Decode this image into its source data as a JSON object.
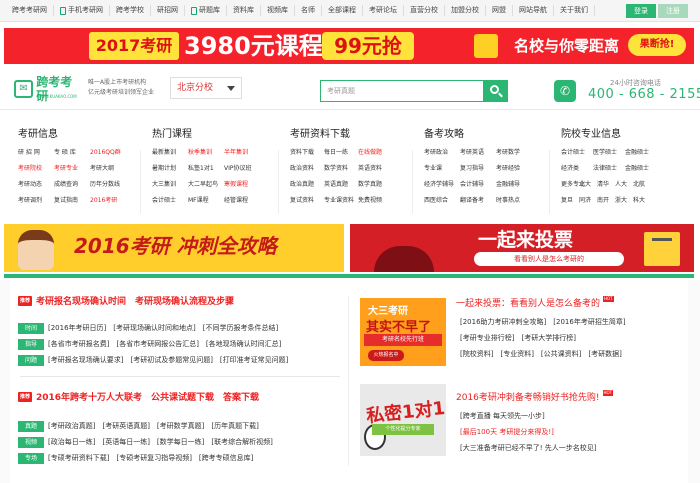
{
  "topbar": {
    "items": [
      "跨考考研网",
      "手机考研网",
      "跨考学校",
      "研招网",
      "研题库",
      "资料库",
      "视频库",
      "名师",
      "全部课程",
      "考研论坛",
      "直营分校",
      "加盟分校",
      "网盟",
      "网站导航",
      "关于我们"
    ],
    "login": "登录",
    "register": "注册",
    "colors": {
      "login": "#2bb673",
      "register": "#a9d9bd"
    }
  },
  "banner": {
    "year": "2017考研",
    "price": "3980元课程",
    "deal": "99元抢",
    "slogan": "名校与你零距离",
    "cta": "果断抢!"
  },
  "header": {
    "logo_name": "跨考考研",
    "logo_sub": "WWW.KUAKAO.COM",
    "slogan1": "唯一A股上市考研机构",
    "slogan2": "亿元级考研培训领军企业",
    "city": "北京分校",
    "search_placeholder": "考研真题",
    "tel_label": "24小时咨询电话",
    "tel": "400 - 668 - 2155"
  },
  "cols": [
    {
      "title": "考研信息",
      "rows": [
        [
          "研 招 网",
          "专 硕 库",
          "2016QQ群"
        ],
        [
          "考研院校",
          "考研专业",
          "考研大纲"
        ],
        [
          "考研动态",
          "成绩查询",
          "历年分数线"
        ],
        [
          "考研调剂",
          "复试指南",
          "2016考研"
        ]
      ],
      "red": [
        [
          0,
          2
        ],
        [
          1,
          0
        ],
        [
          1,
          1
        ],
        [
          3,
          2
        ]
      ]
    },
    {
      "title": "热门课程",
      "rows": [
        [
          "最新集训",
          "秋季集训",
          "半年集训"
        ],
        [
          "暑期计划",
          "私塾1对1",
          "VIP协议班"
        ],
        [
          "大三集训",
          "大二早起鸟",
          "寒假课程"
        ],
        [
          "会计硕士",
          "MF课程",
          "经管课程"
        ]
      ],
      "red": [
        [
          0,
          1
        ],
        [
          0,
          2
        ],
        [
          2,
          2
        ]
      ]
    },
    {
      "title": "考研资料下载",
      "rows": [
        [
          "资料下载",
          "每日一练",
          "在线做题"
        ],
        [
          "政治资料",
          "数学资料",
          "英语资料"
        ],
        [
          "政治真题",
          "英语真题",
          "数学真题"
        ],
        [
          "复试资料",
          "专业课资料",
          "免费视频"
        ]
      ],
      "red": [
        [
          0,
          2
        ]
      ]
    },
    {
      "title": "备考攻略",
      "rows": [
        [
          "考研政治",
          "考研英语",
          "考研数学"
        ],
        [
          "专业课",
          "复习指导",
          "考研经验"
        ],
        [
          "经济学辅导",
          "会计辅导",
          "金融辅导"
        ],
        [
          "西医综合",
          "翻译备考",
          "时事热点"
        ]
      ],
      "red": []
    },
    {
      "title": "院校专业信息",
      "rows": [
        [
          "会计硕士",
          "医学硕士",
          "金融硕士"
        ],
        [
          "经济类",
          "法律硕士",
          "金融硕士"
        ],
        [
          "更多专业",
          "北大",
          "清华",
          "人大",
          "北航"
        ],
        [
          "复旦",
          "同济",
          "南开",
          "浙大",
          "科大"
        ]
      ],
      "red": []
    }
  ],
  "ads": {
    "left": "2016考研 冲刺全攻略",
    "right_title": "一起来投票",
    "right_sub": "看看别人是怎么考研的"
  },
  "news": {
    "h1": "考研报名现场确认时间　考研现场确认流程及步骤",
    "tag": "推荐",
    "rows1": [
      {
        "label": "时间",
        "text": "[2016年考研日历]　[考研现场确认时间和地点]　[不同学历报考条件总结]"
      },
      {
        "label": "指导",
        "text": "[各省市考研报名费]　[各省市考研网报公告汇总]　[各地现场确认时间汇总]"
      },
      {
        "label": "问题",
        "text": "[考研报名现场确认要求]　[考研初试及参题常见问题]　[打印准考证常见问题]"
      }
    ],
    "h2": "2016年跨考十万人大联考　公共课试题下载　答案下载",
    "rows2": [
      {
        "label": "真题",
        "text": "[考研政治真题]　[考研英语真题]　[考研数学真题]　[历年真题下载]"
      },
      {
        "label": "视频",
        "text": "[政治每日一练]　[英语每日一练]　[数学每日一练]　[联考综合解析视频]"
      },
      {
        "label": "专场",
        "text": "[专硕考研资料下载]　[专硕考研复习指导视频]　[跨考专硕信息库]"
      }
    ]
  },
  "right": {
    "pic1": {
      "a": "大三考研",
      "b": "其实不早了",
      "c": "考研名校先行班",
      "d": "火热报名中"
    },
    "t1": "一起来投票：看看别人是怎么备考的",
    "l1": [
      "[2016助力考研冲刺全攻略]　[2016年考研招生简章]",
      "[考研专业排行榜]　[考研大学排行榜]",
      "[院校资料]　[专业资料]　[公共课资料]　[考研数据]"
    ],
    "pic2": {
      "a": "私密1对1",
      "b": "个性化提分专家"
    },
    "t2": "2016考研冲刺备考畅销好书抢先购!",
    "l2": [
      "[跨考直播 每天领先一小步]",
      "[最后100天 考研提分来得及!]",
      "[大三准备考研已经不早了! 先人一步名校见]"
    ],
    "hot": "HOT"
  }
}
